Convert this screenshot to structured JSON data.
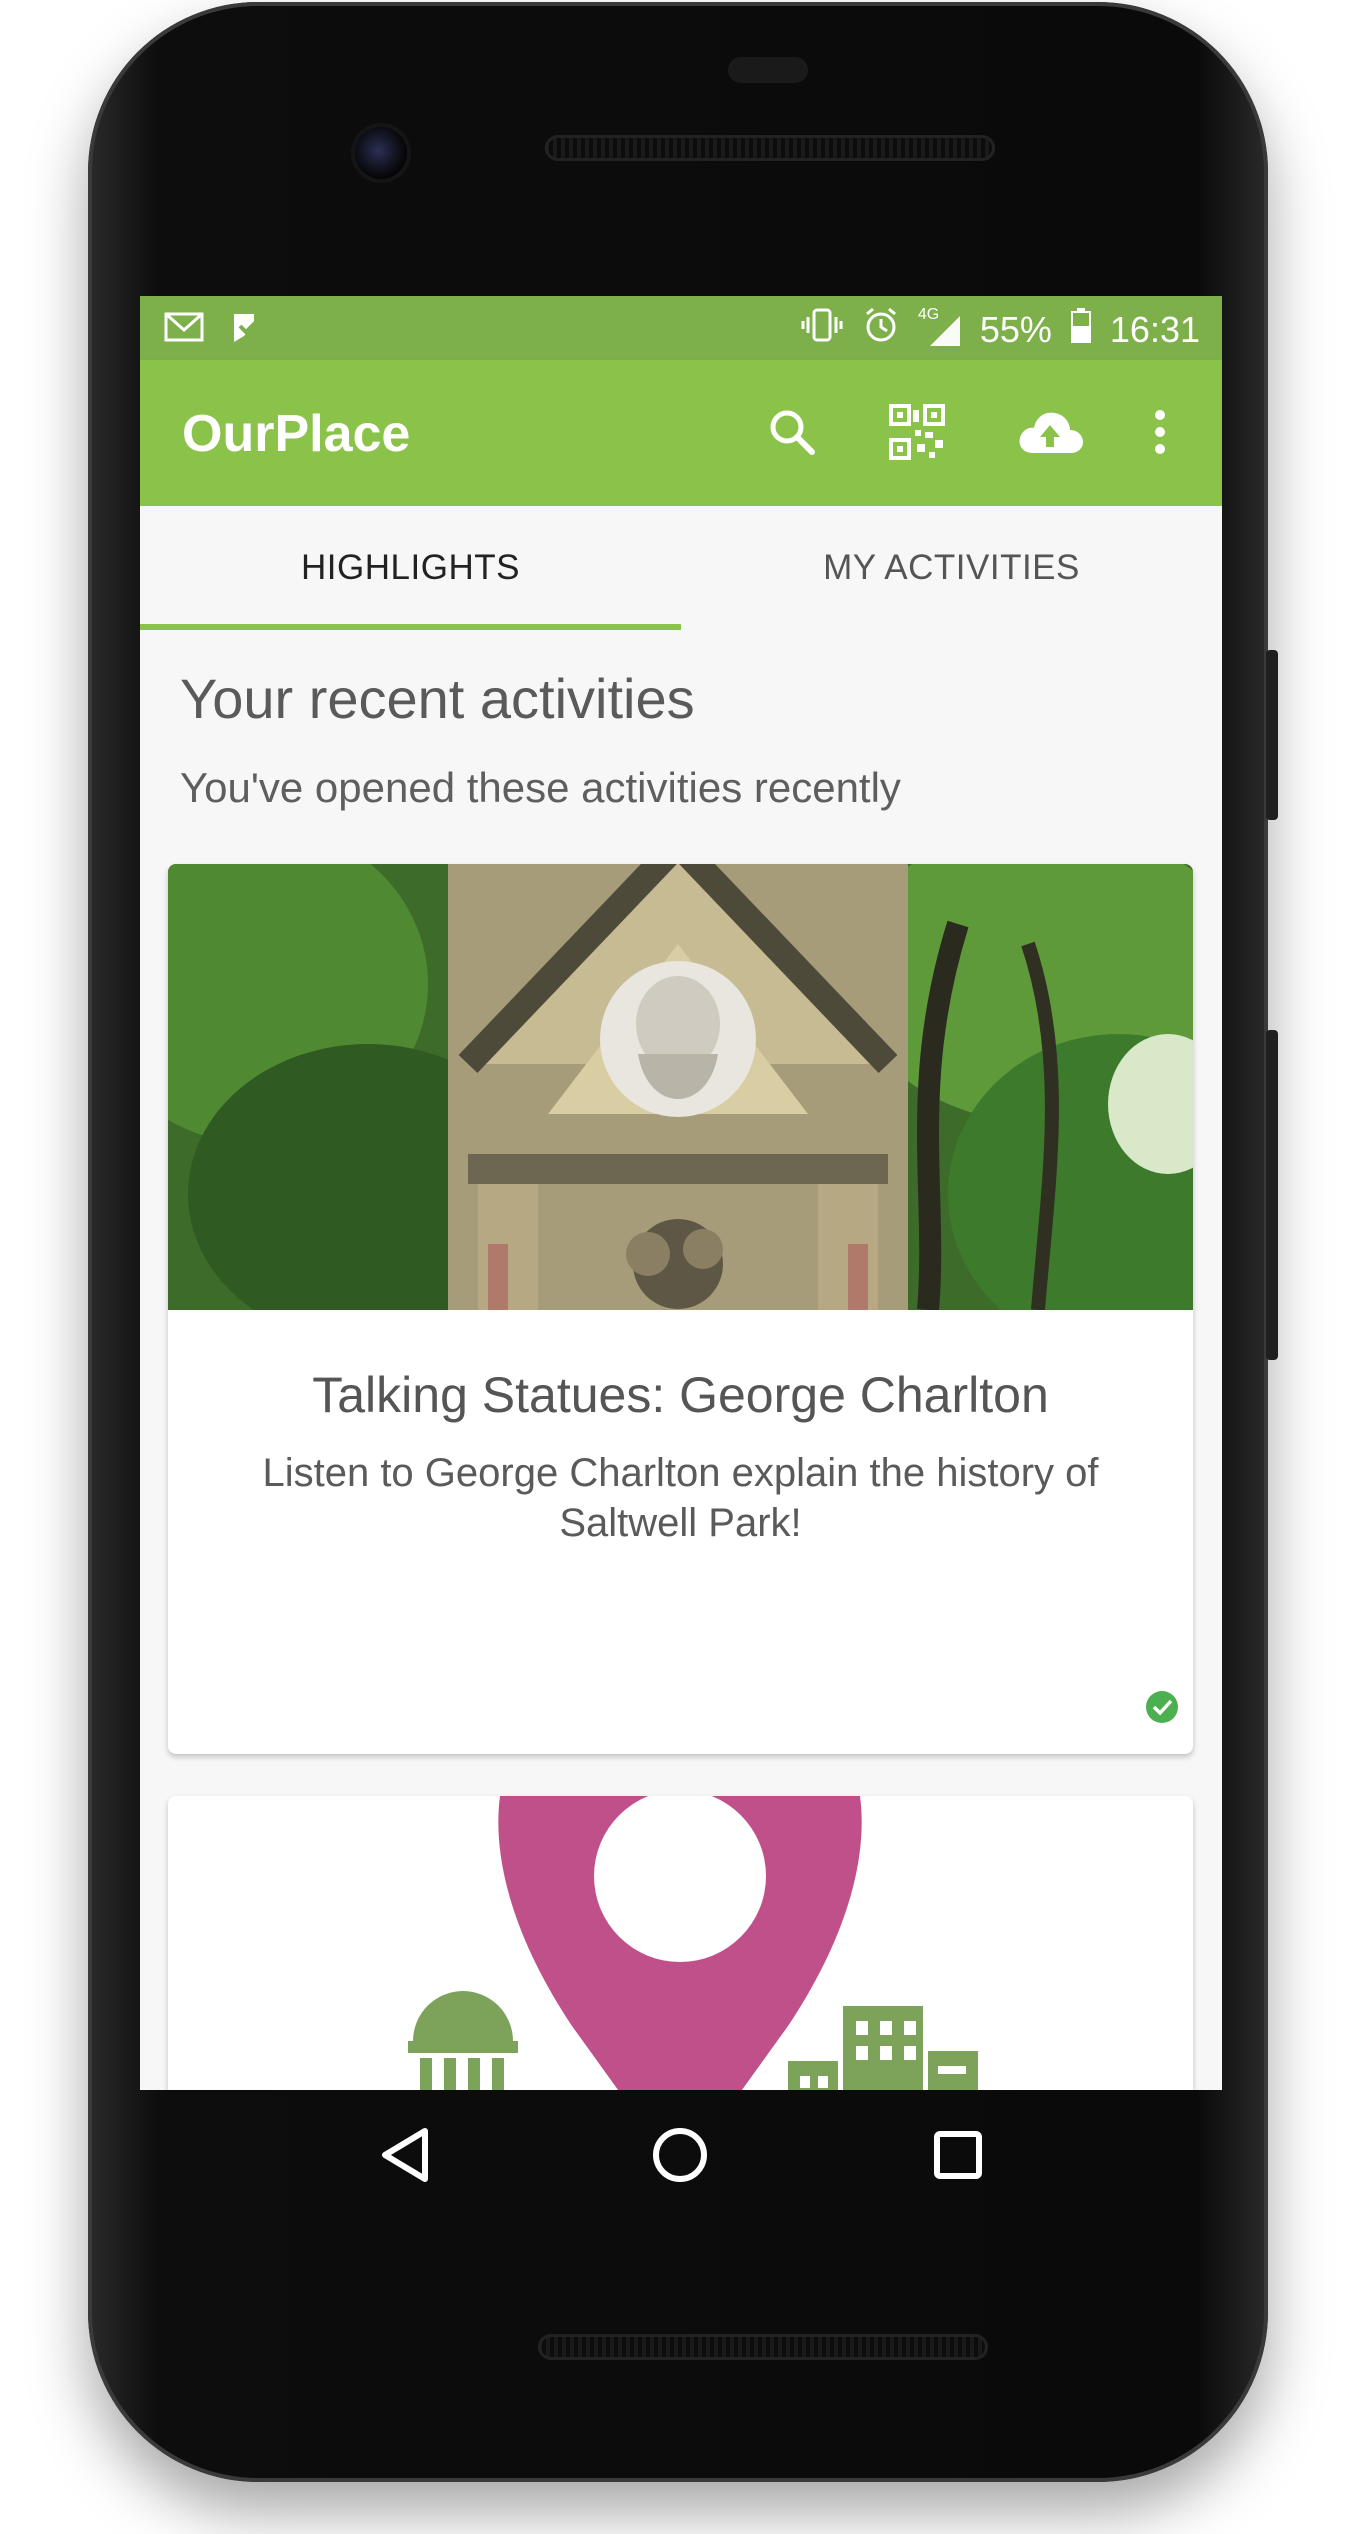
{
  "status_bar": {
    "notification_icons": [
      "gmail-icon",
      "task-check-icon"
    ],
    "system_icons": [
      "vibrate-icon",
      "alarm-icon",
      "signal-4g-icon",
      "battery-icon"
    ],
    "network": "4G",
    "battery": "55%",
    "time": "16:31"
  },
  "toolbar": {
    "title": "OurPlace",
    "actions": [
      "search-icon",
      "qr-code-icon",
      "cloud-upload-icon",
      "more-vert-icon"
    ],
    "accent_color": "#8bc34a"
  },
  "tabs": [
    {
      "label": "HIGHLIGHTS",
      "active": true
    },
    {
      "label": "MY ACTIVITIES",
      "active": false
    }
  ],
  "section": {
    "title": "Your recent activities",
    "subtitle": "You've opened these activities recently"
  },
  "cards": [
    {
      "title": "Talking Statues: George Charlton",
      "description": "Listen to George Charlton explain the history of Saltwell Park!",
      "image": "statue-photo",
      "status_icon": "check-circle-icon",
      "status_color": "#4caf50"
    },
    {
      "image": "location-pin-illustration",
      "pin_color": "#c0508a",
      "building_color": "#7da35a"
    }
  ],
  "nav_bar": [
    "back-icon",
    "home-icon",
    "recents-icon"
  ]
}
